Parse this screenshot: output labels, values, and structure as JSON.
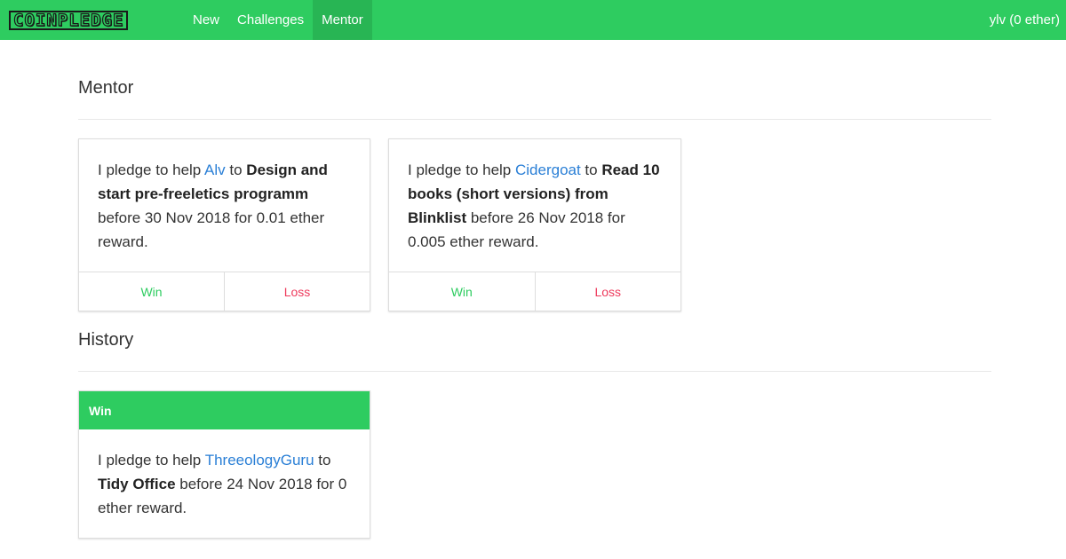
{
  "navbar": {
    "brand": "COINPLEDGE",
    "items": [
      {
        "label": "New"
      },
      {
        "label": "Challenges"
      },
      {
        "label": "Mentor"
      }
    ],
    "user": "ylv (0 ether)",
    "active_color": "#28b554",
    "bg_color": "#2ecc60"
  },
  "mentor": {
    "title": "Mentor",
    "cards": [
      {
        "prefix": "I pledge to help ",
        "name": "Alv",
        "to": " to ",
        "task": "Design and start pre-freeletics programm",
        "suffix": " before 30 Nov 2018 for 0.01 ether reward.",
        "win_label": "Win",
        "loss_label": "Loss"
      },
      {
        "prefix": "I pledge to help ",
        "name": "Cidergoat",
        "to": " to ",
        "task": "Read 10 books (short versions) from Blinklist",
        "suffix": " before 26 Nov 2018 for 0.005 ether reward.",
        "win_label": "Win",
        "loss_label": "Loss"
      }
    ]
  },
  "history": {
    "title": "History",
    "cards": [
      {
        "status": "Win",
        "prefix": "I pledge to help ",
        "name": "ThreeologyGuru",
        "to": " to ",
        "task": "Tidy Office",
        "suffix": " before 24 Nov 2018 for 0 ether reward."
      }
    ]
  },
  "colors": {
    "win": "#2ecc60",
    "loss": "#ee3a5c",
    "link": "#2a7fd6"
  }
}
